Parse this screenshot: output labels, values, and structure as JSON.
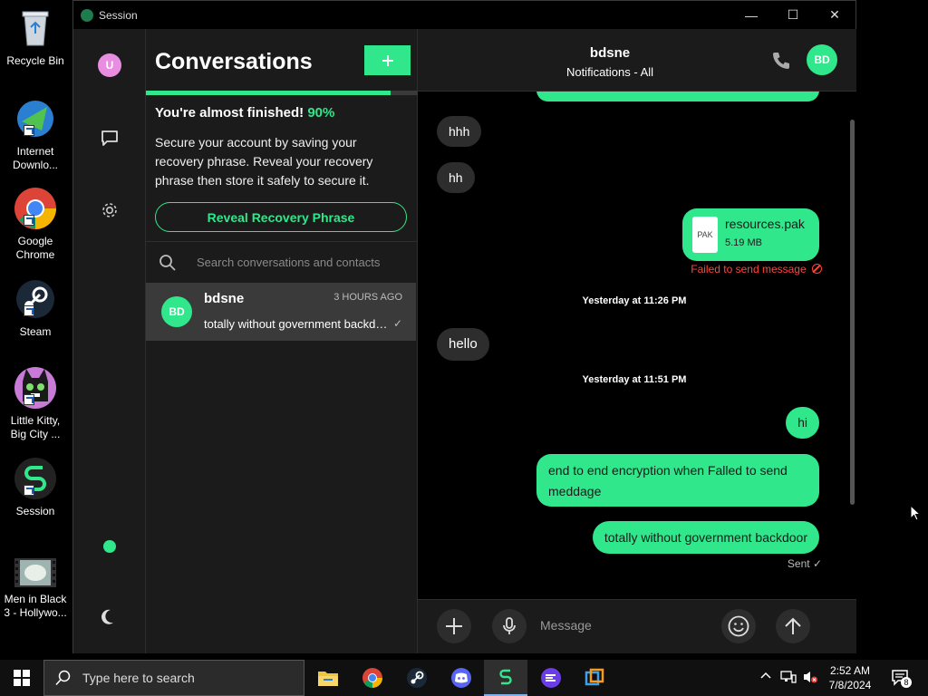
{
  "desktop": {
    "icons": [
      {
        "label": "Recycle Bin",
        "icon": "recycle-bin-icon"
      },
      {
        "label": "Internet Downlo...",
        "icon": "internet-download-manager-icon"
      },
      {
        "label": "Google Chrome",
        "icon": "chrome-icon"
      },
      {
        "label": "Steam",
        "icon": "steam-icon"
      },
      {
        "label": "Little Kitty, Big City ...",
        "icon": "little-kitty-icon"
      },
      {
        "label": "Session",
        "icon": "session-icon"
      },
      {
        "label": "Men in Black 3 - Hollywo...",
        "icon": "video-file-icon"
      }
    ]
  },
  "window": {
    "title": "Session",
    "controls": {
      "minimize": "—",
      "maximize": "☐",
      "close": "✕"
    }
  },
  "rail": {
    "avatar_initial": "U",
    "avatar_color": "#e88de0",
    "online_color": "#31e78b"
  },
  "conversations": {
    "title": "Conversations",
    "compose_label": "+",
    "progress_fraction": 0.9,
    "banner": {
      "title": "You're almost finished!",
      "percent": "90%",
      "text": "Secure your account by saving your recovery phrase. Reveal your recovery phrase then store it safely to secure it.",
      "button": "Reveal Recovery Phrase"
    },
    "search_placeholder": "Search conversations and contacts",
    "items": [
      {
        "initials": "BD",
        "name": "bdsne",
        "time": "3 HOURS AGO",
        "preview": "totally without government backdoor",
        "status": "✓"
      }
    ]
  },
  "chat": {
    "name": "bdsne",
    "subtitle": "Notifications - All",
    "avatar_initials": "BD",
    "accent": "#31e78b",
    "messages": {
      "m1": "hhh",
      "m2": "hh",
      "file_name": "resources.pak",
      "file_size": "5.19 MB",
      "file_ext": "PAK",
      "failed": "Failed to send message",
      "sep1": "Yesterday at 11:26 PM",
      "m3": "hello",
      "sep2": "Yesterday at 11:51 PM",
      "m4": "hi",
      "m5": "end to end encryption when Falled to send meddage",
      "m6": "totally without government backdoor",
      "sent": "Sent ✓"
    },
    "composer_placeholder": "Message"
  },
  "taskbar": {
    "search_placeholder": "Type here to search",
    "apps": [
      "file-explorer-icon",
      "chrome-icon",
      "steam-icon",
      "discord-icon",
      "session-icon",
      "app-icon-purple",
      "app-icon-blue"
    ],
    "time": "2:52 AM",
    "date": "7/8/2024",
    "notification_count": "8"
  }
}
